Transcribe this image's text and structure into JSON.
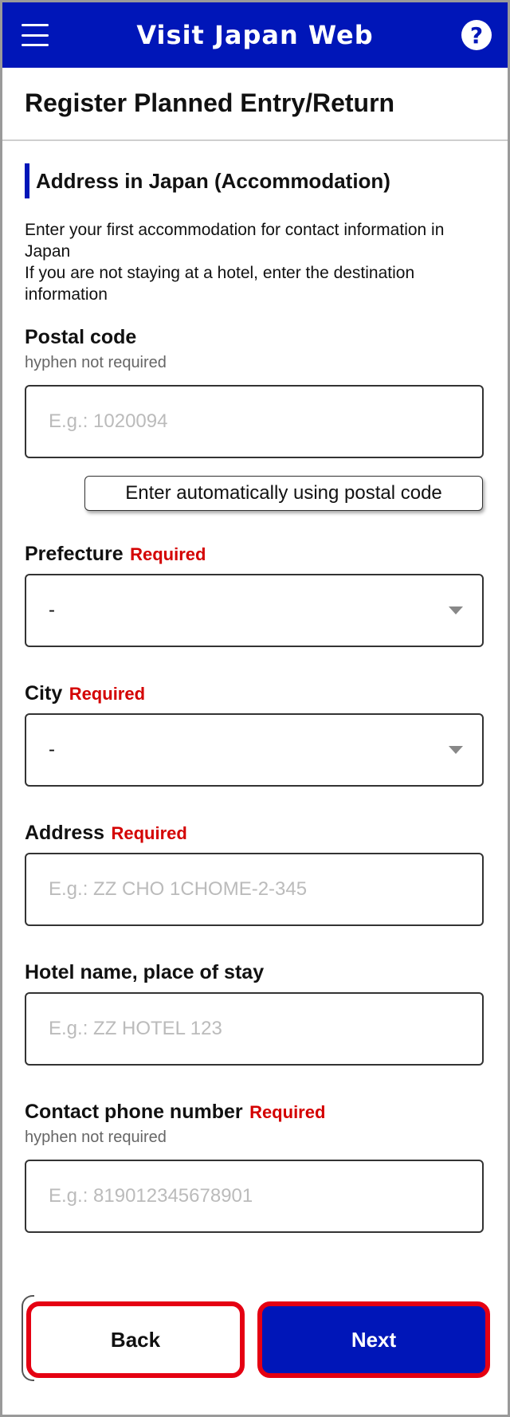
{
  "header": {
    "title": "Visit Japan Web",
    "menu_icon": "hamburger-icon",
    "help_icon": "help-icon",
    "help_glyph": "?"
  },
  "page": {
    "title": "Register Planned Entry/Return"
  },
  "section": {
    "title": "Address in Japan (Accommodation)",
    "description_line1": "Enter your first accommodation for contact information in Japan",
    "description_line2": "If you are not staying at a hotel, enter the destination information"
  },
  "postal": {
    "label": "Postal code",
    "hint": "hyphen not required",
    "placeholder": "E.g.: 1020094",
    "auto_button": "Enter automatically using postal code"
  },
  "prefecture": {
    "label": "Prefecture",
    "required": "Required",
    "value": "-"
  },
  "city": {
    "label": "City",
    "required": "Required",
    "value": "-"
  },
  "address": {
    "label": "Address",
    "required": "Required",
    "placeholder": "E.g.: ZZ CHO 1CHOME-2-345"
  },
  "hotel": {
    "label": "Hotel name, place of stay",
    "placeholder": "E.g.: ZZ HOTEL 123"
  },
  "phone": {
    "label": "Contact phone number",
    "required": "Required",
    "hint": "hyphen not required",
    "placeholder": "E.g.: 819012345678901"
  },
  "footer": {
    "back": "Back",
    "next": "Next"
  },
  "colors": {
    "brand": "#0016b8",
    "required": "#d40000",
    "highlight": "#e50012"
  }
}
